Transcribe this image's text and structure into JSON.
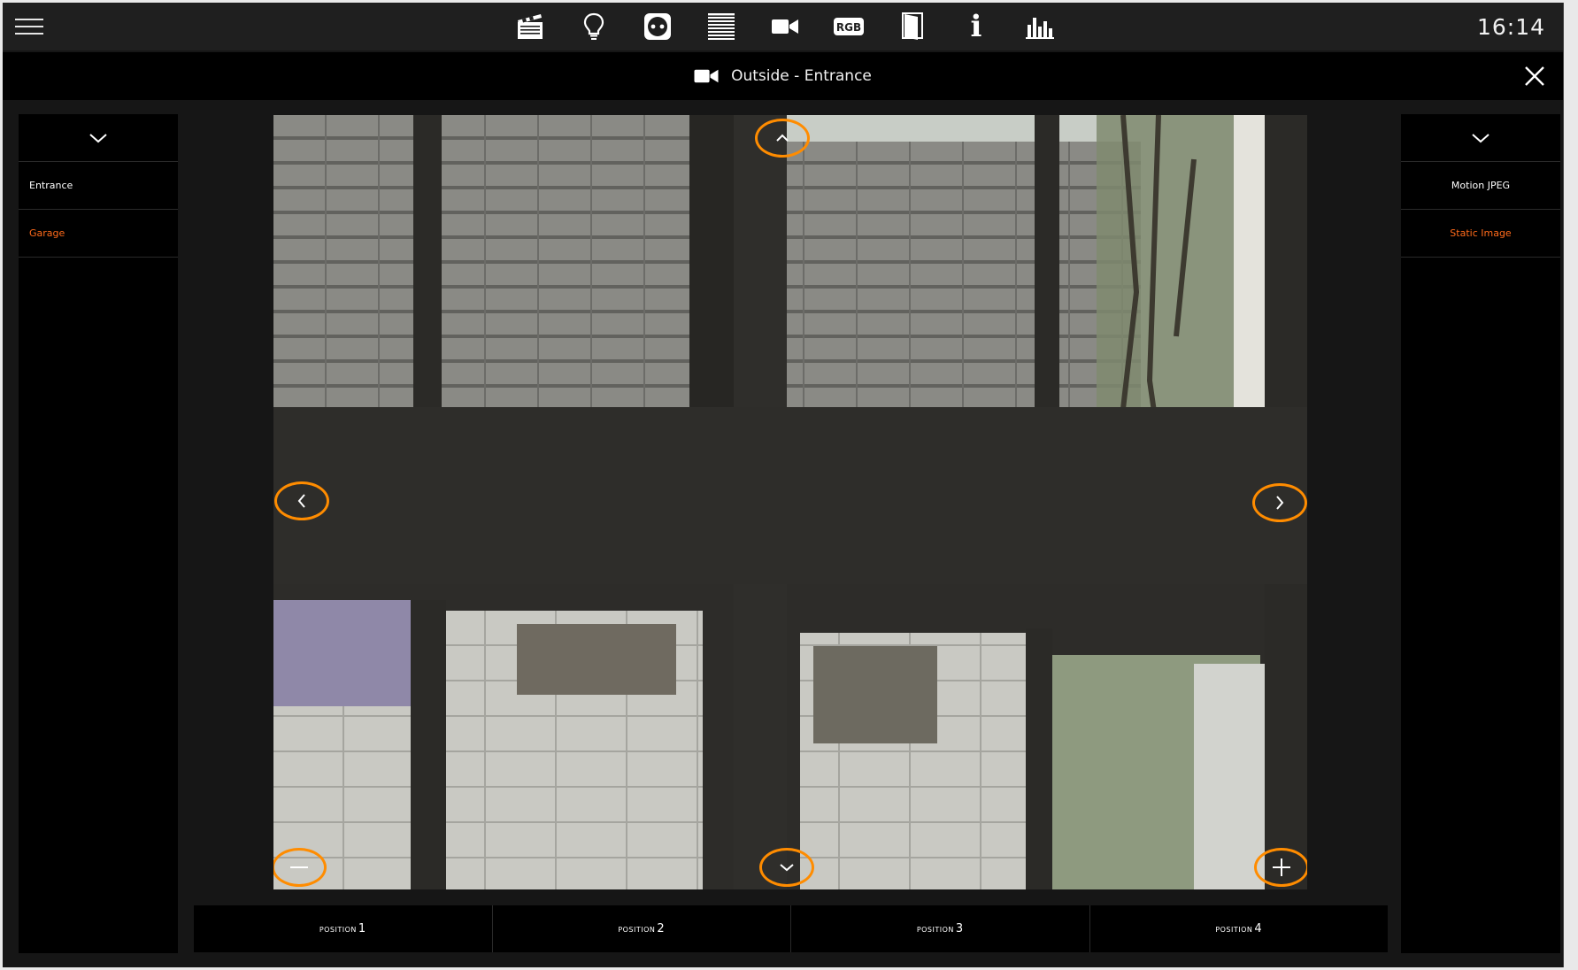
{
  "topbar": {
    "clock": "16:14",
    "icons": [
      "scenes-clapperboard-icon",
      "lightbulb-icon",
      "socket-icon",
      "blinds-icon",
      "camera-icon",
      "rgb-icon",
      "door-icon",
      "info-icon",
      "energy-chart-icon"
    ],
    "rgb_label": "RGB",
    "info_label": "i"
  },
  "titlebar": {
    "title": "Outside - Entrance"
  },
  "left_panel": {
    "items": [
      {
        "label": "Entrance",
        "active": false
      },
      {
        "label": "Garage",
        "active": true
      }
    ]
  },
  "right_panel": {
    "items": [
      {
        "label": "Motion JPEG",
        "active": false
      },
      {
        "label": "Static Image",
        "active": true
      }
    ]
  },
  "positions": [
    {
      "word": "Position",
      "num": "1"
    },
    {
      "word": "Position",
      "num": "2"
    },
    {
      "word": "Position",
      "num": "3"
    },
    {
      "word": "Position",
      "num": "4"
    }
  ],
  "colors": {
    "accent": "#ff8c00",
    "active_text": "#ff6a1a",
    "bar": "#1f1f1f",
    "panel": "#000000"
  }
}
